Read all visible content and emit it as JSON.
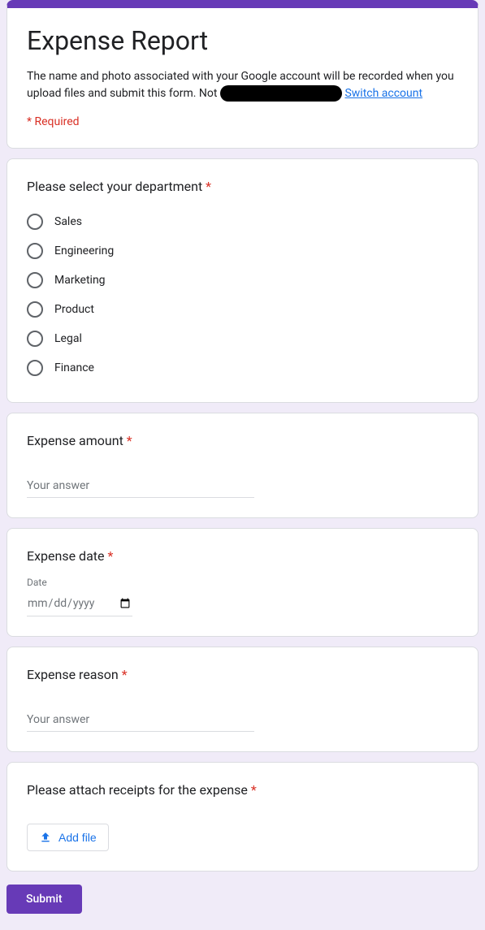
{
  "header": {
    "title": "Expense Report",
    "desc_prefix": "The name and photo associated with your Google account will be recorded when you upload files and submit this form. Not",
    "switch_link": "Switch account",
    "required_note": "* Required"
  },
  "questions": {
    "department": {
      "label": "Please select your department",
      "options": [
        "Sales",
        "Engineering",
        "Marketing",
        "Product",
        "Legal",
        "Finance"
      ]
    },
    "amount": {
      "label": "Expense amount",
      "placeholder": "Your answer"
    },
    "date": {
      "label": "Expense date",
      "sublabel": "Date",
      "placeholder": "mm/dd/yyyy"
    },
    "reason": {
      "label": "Expense reason",
      "placeholder": "Your answer"
    },
    "receipts": {
      "label": "Please attach receipts for the expense",
      "button": "Add file"
    }
  },
  "submit_label": "Submit",
  "required_marker": "*"
}
